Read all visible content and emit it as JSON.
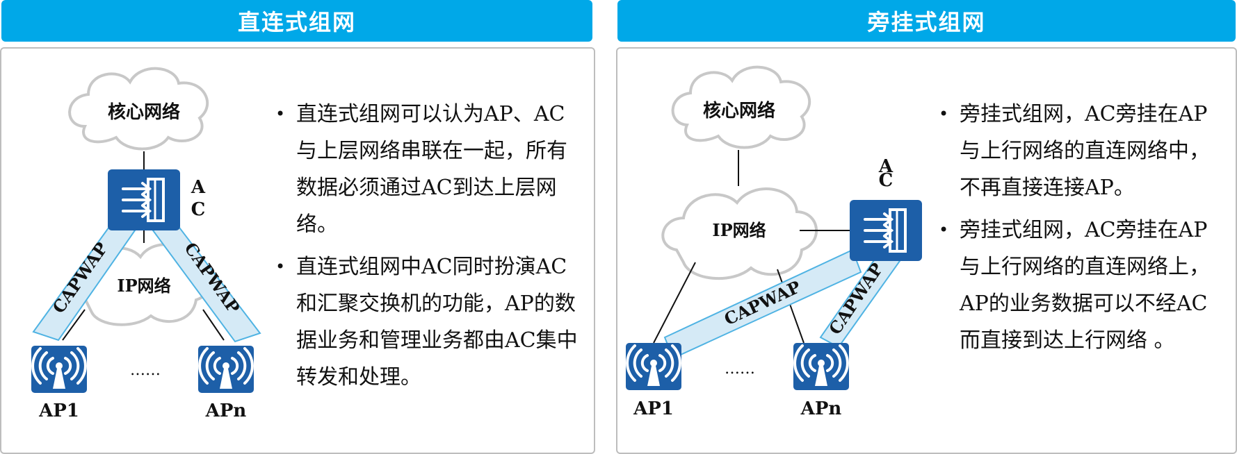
{
  "left": {
    "header": "直连式组网",
    "cloud_core": "核心网络",
    "cloud_ip": "IP网络",
    "ac_label": "A\nC",
    "capwap_left": "CAPWAP",
    "capwap_right": "CAPWAP",
    "ap1": "AP1",
    "apn": "APn",
    "dots": "……",
    "bullets": [
      "直连式组网可以认为AP、AC与上层网络串联在一起，所有数据必须通过AC到达上层网络。",
      "直连式组网中AC同时扮演AC和汇聚交换机的功能，AP的数据业务和管理业务都由AC集中转发和处理。"
    ]
  },
  "right": {
    "header": "旁挂式组网",
    "cloud_core": "核心网络",
    "cloud_ip": "IP网络",
    "ac_label": "A\nC",
    "capwap_left": "CAPWAP",
    "capwap_right": "CAPWAP",
    "ap1": "AP1",
    "apn": "APn",
    "dots": "……",
    "bullets": [
      "旁挂式组网，AC旁挂在AP与上行网络的直连网络中，不再直接连接AP。",
      "旁挂式组网，AC旁挂在AP与上行网络的直连网络上，AP的业务数据可以不经AC而直接到达上行网络 。"
    ]
  },
  "colors": {
    "header": "#00a8e8",
    "device": "#1d5fa8",
    "tunnel": "#d5eaf6",
    "tunnel_border": "#4fb3e3"
  }
}
